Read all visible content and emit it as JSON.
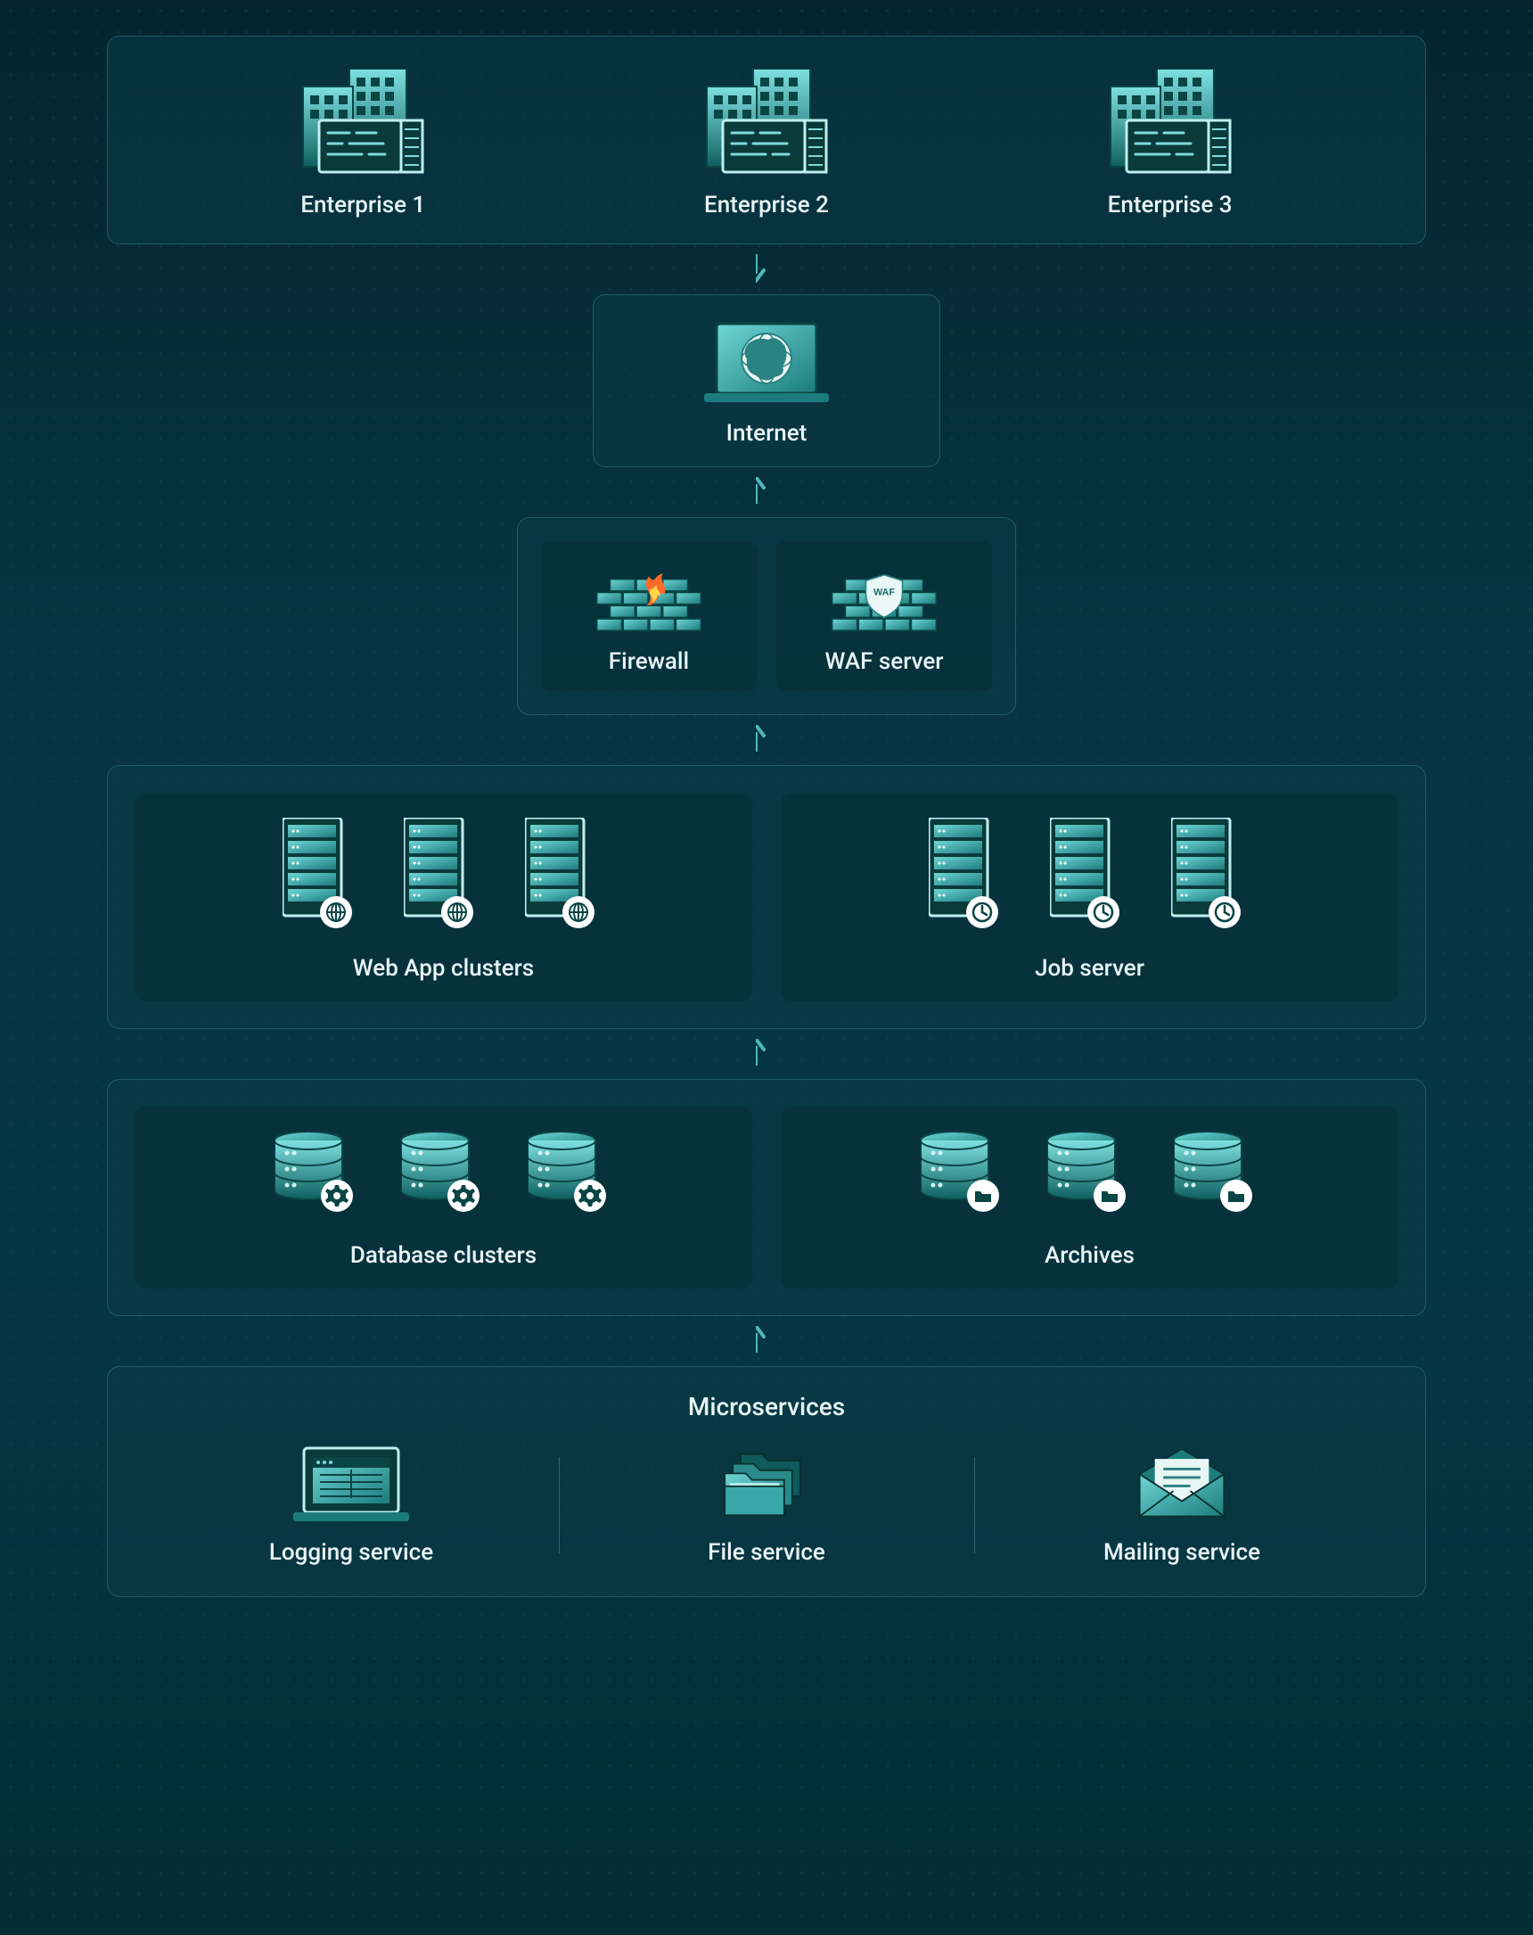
{
  "enterprises": {
    "items": [
      {
        "label": "Enterprise 1"
      },
      {
        "label": "Enterprise 2"
      },
      {
        "label": "Enterprise 3"
      }
    ]
  },
  "internet": {
    "label": "Internet"
  },
  "security": {
    "firewall_label": "Firewall",
    "waf_label": "WAF server",
    "waf_badge_text": "WAF"
  },
  "app_tier": {
    "web_label": "Web App clusters",
    "job_label": "Job server"
  },
  "db_tier": {
    "db_label": "Database clusters",
    "archive_label": "Archives"
  },
  "micro": {
    "title": "Microservices",
    "logging_label": "Logging service",
    "file_label": "File service",
    "mailing_label": "Mailing service"
  },
  "colors": {
    "accent": "#3aa8a8",
    "accent_light": "#8fe0e0",
    "panel_border": "#2b6a77"
  }
}
